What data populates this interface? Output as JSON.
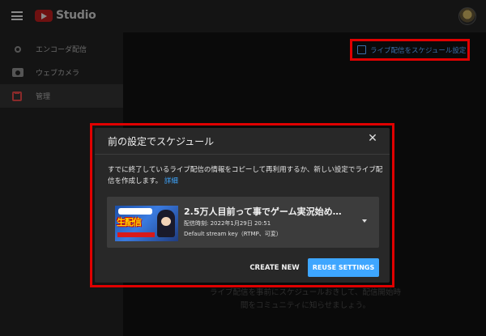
{
  "app": {
    "logo_text": "Studio"
  },
  "sidebar": {
    "items": [
      {
        "label": "エンコーダ配信",
        "icon": "broadcast-icon"
      },
      {
        "label": "ウェブカメラ",
        "icon": "camera-icon"
      },
      {
        "label": "管理",
        "icon": "calendar-icon",
        "active": true
      }
    ]
  },
  "header": {
    "schedule_button_label": "ライブ配信をスケジュール設定"
  },
  "background": {
    "hint_line1": "ライブ配信を事前にスケジュールおきして、配信開始時",
    "hint_line2": "間をコミュニティに知らせましょう。"
  },
  "dialog": {
    "title": "前の設定でスケジュール",
    "close_icon": "close-icon",
    "description": "すでに終了しているライブ配信の情報をコピーして再利用するか、新しい設定でライブ配信を作成します。",
    "link_label": "詳細",
    "stream": {
      "title": "2.5万人目前って事でゲーム実況始め…",
      "date": "配信時刻: 2022年1月29日 20:51",
      "stream_key": "Default stream key（RTMP、可変）",
      "thumbnail_text": "生配信"
    },
    "create_label": "CREATE NEW",
    "reuse_label": "REUSE SETTINGS"
  },
  "colors": {
    "accent": "#3ea6ff",
    "highlight": "#e00000",
    "dialog_bg": "#282828",
    "card_bg": "#3c3c3c"
  }
}
